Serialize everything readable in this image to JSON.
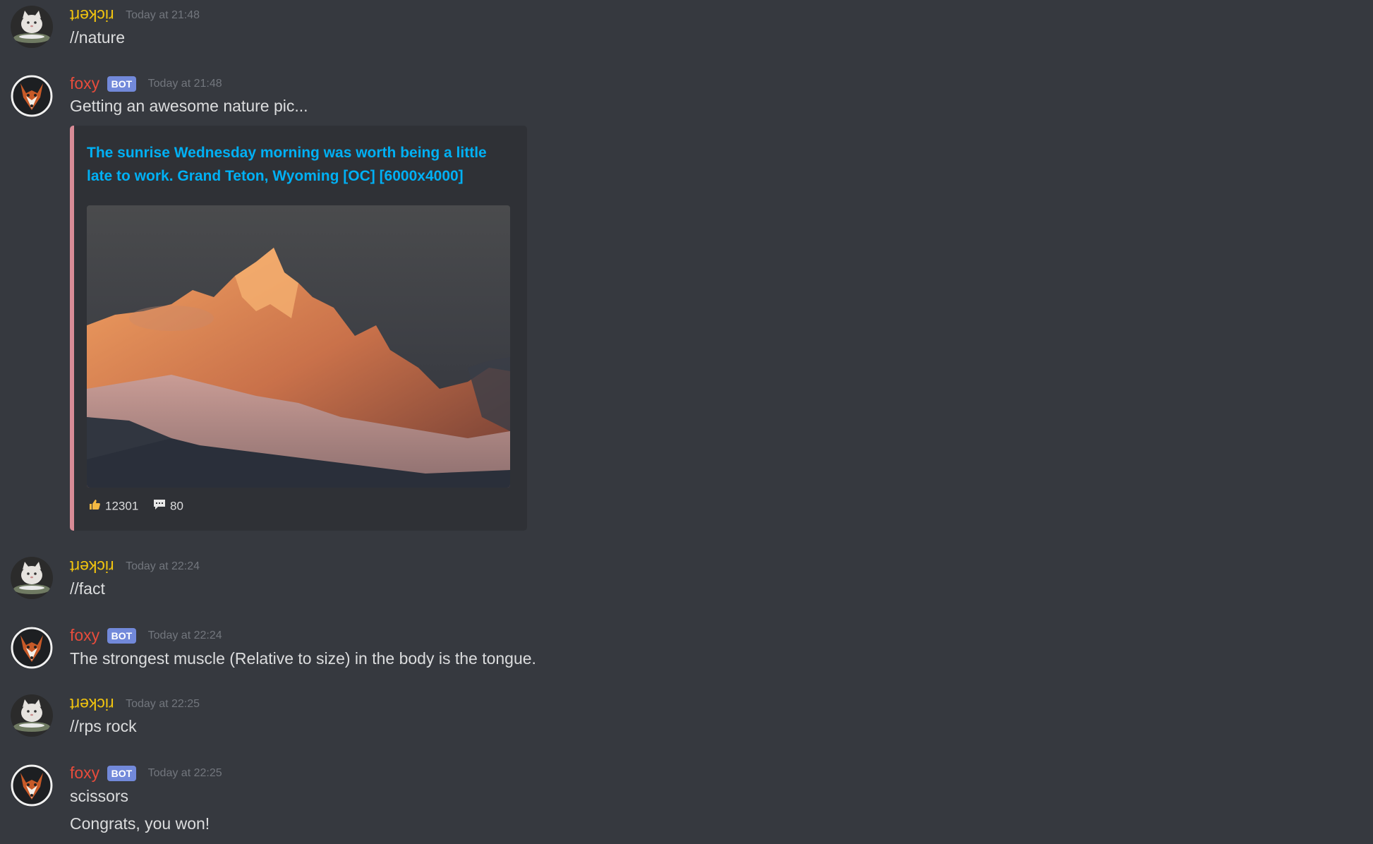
{
  "messages": [
    {
      "user": "rickert",
      "ts": "Today at 21:48",
      "lines": [
        "//nature"
      ]
    },
    {
      "user": "foxy",
      "bot": "BOT",
      "ts": "Today at 21:48",
      "lines": [
        "Getting an awesome nature pic..."
      ],
      "embed": {
        "title": "The sunrise Wednesday morning was worth being a little late to work. Grand Teton, Wyoming [OC] [6000x4000]",
        "likes": "12301",
        "comments": "80"
      }
    },
    {
      "user": "rickert",
      "ts": "Today at 22:24",
      "lines": [
        "//fact"
      ]
    },
    {
      "user": "foxy",
      "bot": "BOT",
      "ts": "Today at 22:24",
      "lines": [
        "The strongest muscle (Relative to size) in the body is the tongue."
      ]
    },
    {
      "user": "rickert",
      "ts": "Today at 22:25",
      "lines": [
        "//rps rock"
      ]
    },
    {
      "user": "foxy",
      "bot": "BOT",
      "ts": "Today at 22:25",
      "lines": [
        "scissors",
        "Congrats, you won!"
      ]
    }
  ],
  "icons": {
    "like": "thumbs-up-icon",
    "comment": "speech-bubble-icon"
  },
  "colors": {
    "background": "#36393f",
    "rickert": "#f1c40f",
    "foxy": "#e74c3c",
    "bot_badge": "#7289da",
    "link": "#00b0f4",
    "embed_border": "#d88b96"
  }
}
